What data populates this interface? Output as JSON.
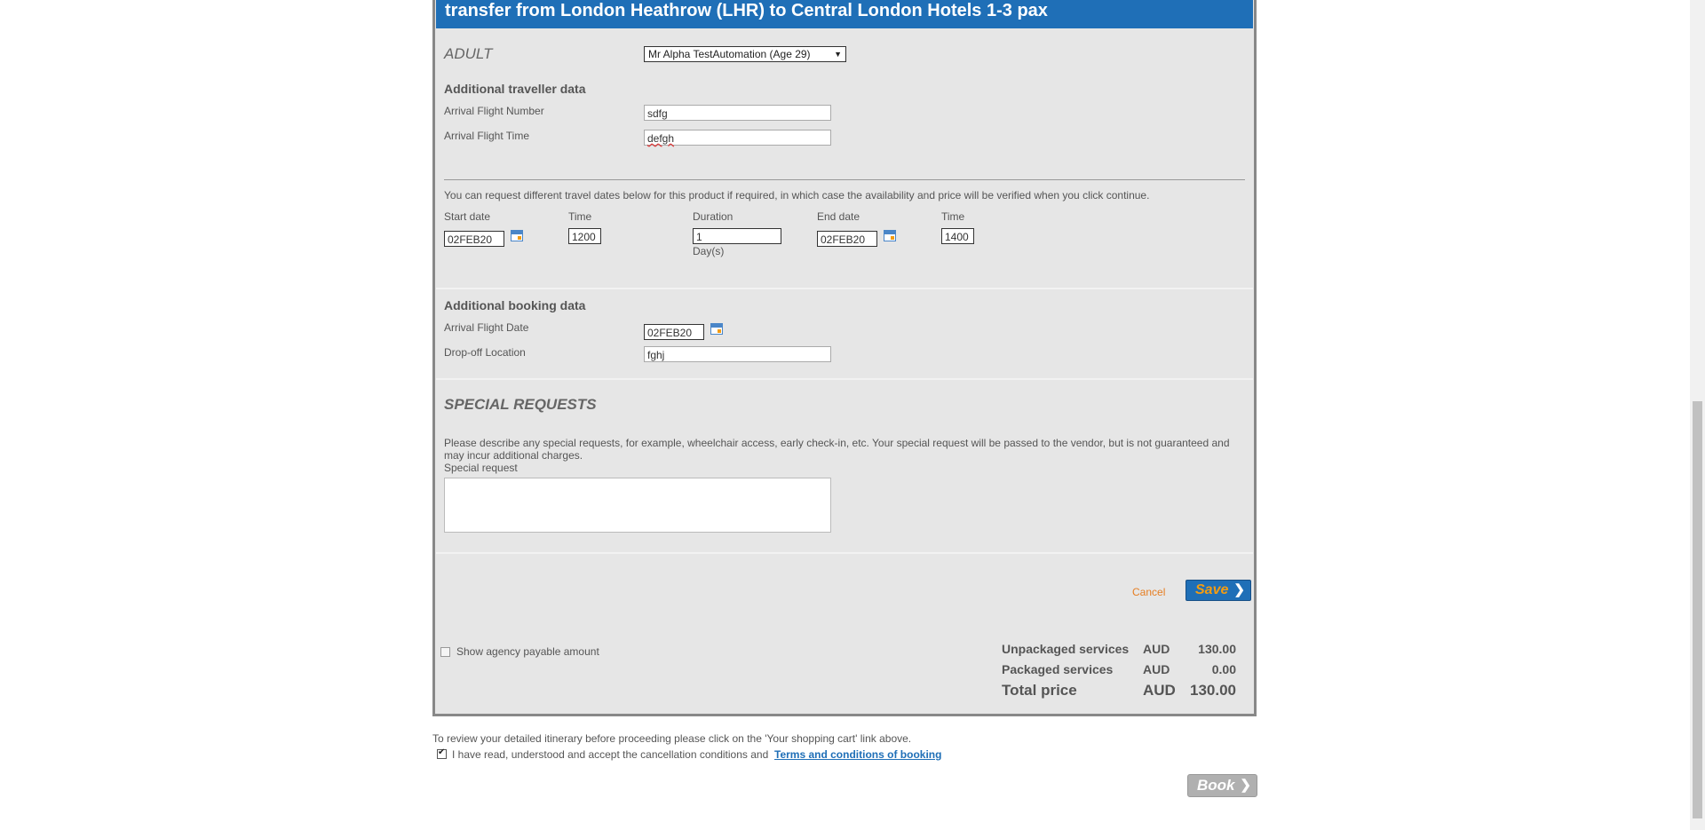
{
  "header": {
    "title": "transfer from London Heathrow (LHR) to Central London Hotels 1-3 pax"
  },
  "traveller": {
    "type_label": "ADULT",
    "selected": "Mr Alpha TestAutomation (Age 29)",
    "additional_heading": "Additional traveller data",
    "flight_number_label": "Arrival Flight Number",
    "flight_number_value": "sdfg",
    "flight_time_label": "Arrival Flight Time",
    "flight_time_value": "defgh"
  },
  "dates": {
    "note": "You can request different travel dates below for this product if required, in which case the availability and price will be verified when you click continue.",
    "start_label": "Start date",
    "start_value": "02FEB20",
    "time1_label": "Time",
    "time1_value": "1200",
    "duration_label": "Duration",
    "duration_value": "1",
    "duration_unit": "Day(s)",
    "end_label": "End date",
    "end_value": "02FEB20",
    "time2_label": "Time",
    "time2_value": "1400"
  },
  "booking": {
    "heading": "Additional booking data",
    "flight_date_label": "Arrival Flight Date",
    "flight_date_value": "02FEB20",
    "dropoff_label": "Drop-off Location",
    "dropoff_value": "fghj"
  },
  "special": {
    "heading": "SPECIAL REQUESTS",
    "description": "Please describe any special requests, for example, wheelchair access, early check-in, etc. Your special request will be passed to the vendor, but is not guaranteed and may incur additional charges.",
    "field_label": "Special request",
    "value": ""
  },
  "actions": {
    "cancel": "Cancel",
    "save": "Save",
    "book": "Book"
  },
  "pricing": {
    "show_agency_label": "Show agency payable amount",
    "rows": [
      {
        "label": "Unpackaged services",
        "currency": "AUD",
        "amount": "130.00"
      },
      {
        "label": "Packaged services",
        "currency": "AUD",
        "amount": "0.00"
      },
      {
        "label": "Total price",
        "currency": "AUD",
        "amount": "130.00"
      }
    ]
  },
  "footer": {
    "review_note": "To review your detailed itinerary before proceeding please click on the 'Your shopping cart' link above.",
    "accept_text": "I have read, understood and accept the cancellation conditions and",
    "terms_link": "Terms and conditions of booking"
  },
  "colors": {
    "brand_blue": "#1f6fb7",
    "accent_orange": "#f39c12",
    "panel_gray": "#e6e6e6"
  }
}
